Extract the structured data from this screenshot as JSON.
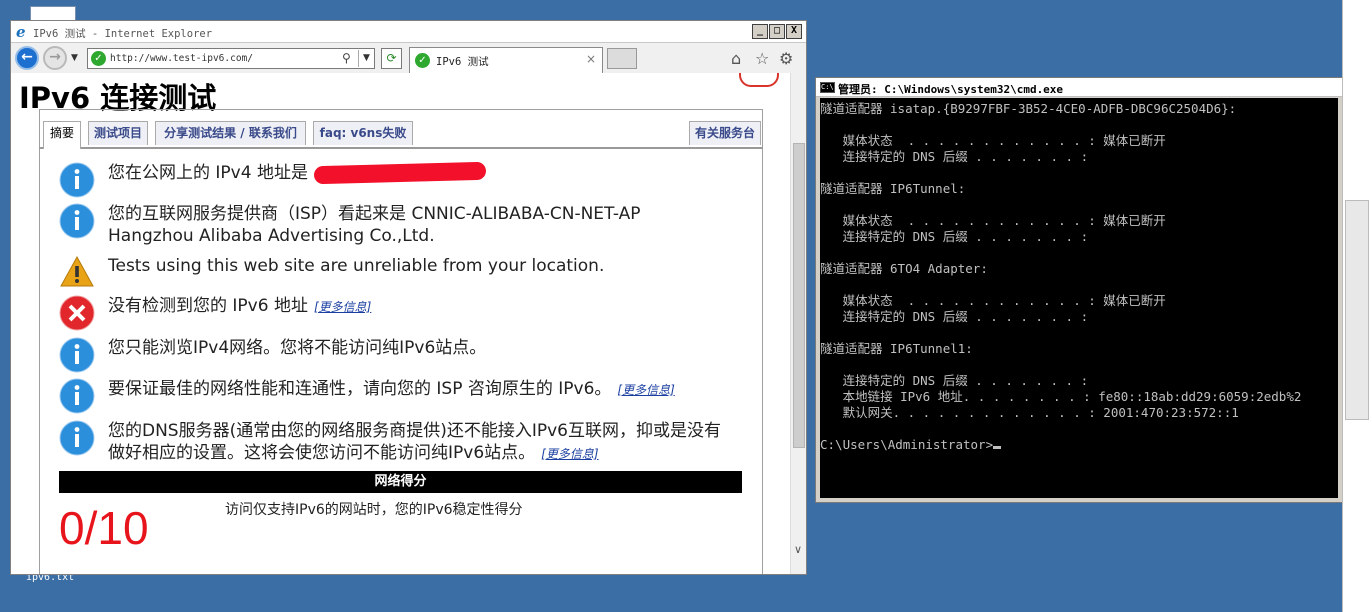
{
  "desktop": {
    "file_label": "ipv6.txt"
  },
  "browser": {
    "title": "IPv6 测试 - Internet Explorer",
    "url": "http://www.test-ipv6.com/",
    "tab_label": "IPv6 测试",
    "window_buttons": [
      "_",
      "□",
      "X"
    ]
  },
  "page": {
    "title": "IPv6 连接测试",
    "tabs": [
      {
        "label": "摘要"
      },
      {
        "label": "测试项目"
      },
      {
        "label": "分享测试结果 / 联系我们"
      },
      {
        "label": "faq: v6ns失败"
      },
      {
        "label": "有关服务台"
      }
    ],
    "messages": [
      {
        "icon": "info",
        "line1": "您在公网上的 IPv4 地址是"
      },
      {
        "icon": "info",
        "line1": "您的互联网服务提供商（ISP）看起来是 CNNIC-ALIBABA-CN-NET-AP",
        "line2": "Hangzhou Alibaba Advertising Co.,Ltd."
      },
      {
        "icon": "warning",
        "line1": "Tests using this web site are unreliable from your location."
      },
      {
        "icon": "error",
        "line1": "没有检测到您的 IPv6 地址",
        "link": "[更多信息]"
      },
      {
        "icon": "info",
        "line1": "您只能浏览IPv4网络。您将不能访问纯IPv6站点。"
      },
      {
        "icon": "info",
        "line1": "要保证最佳的网络性能和连通性，请向您的 ISP 咨询原生的 IPv6。",
        "link": "[更多信息]"
      },
      {
        "icon": "info",
        "line1": "您的DNS服务器(通常由您的网络服务商提供)还不能接入IPv6互联网，抑或是没有",
        "line2": "做好相应的设置。这将会使您访问不能访问纯IPv6站点。",
        "link": "[更多信息]"
      }
    ],
    "score_header": "网络得分",
    "score_value": "0/10",
    "score_desc": "访问仅支持IPv6的网站时，您的IPv6稳定性得分"
  },
  "cmd": {
    "title": "管理员: C:\\Windows\\system32\\cmd.exe",
    "lines": [
      "隧道适配器 isatap.{B9297FBF-3B52-4CE0-ADFB-DBC96C2504D6}:",
      "",
      "   媒体状态  . . . . . . . . . . . . : 媒体已断开",
      "   连接特定的 DNS 后缀 . . . . . . . :",
      "",
      "隧道适配器 IP6Tunnel:",
      "",
      "   媒体状态  . . . . . . . . . . . . : 媒体已断开",
      "   连接特定的 DNS 后缀 . . . . . . . :",
      "",
      "隧道适配器 6TO4 Adapter:",
      "",
      "   媒体状态  . . . . . . . . . . . . : 媒体已断开",
      "   连接特定的 DNS 后缀 . . . . . . . :",
      "",
      "隧道适配器 IP6Tunnel1:",
      "",
      "   连接特定的 DNS 后缀 . . . . . . . :",
      "   本地链接 IPv6 地址. . . . . . . . : fe80::18ab:dd29:6059:2edb%2",
      "   默认网关. . . . . . . . . . . . . : 2001:470:23:572::1",
      "",
      "C:\\Users\\Administrator>"
    ]
  },
  "colors": {
    "desktop": "#3a6ea5",
    "score_red": "#e8141c",
    "link_blue": "#1a3fa0"
  }
}
